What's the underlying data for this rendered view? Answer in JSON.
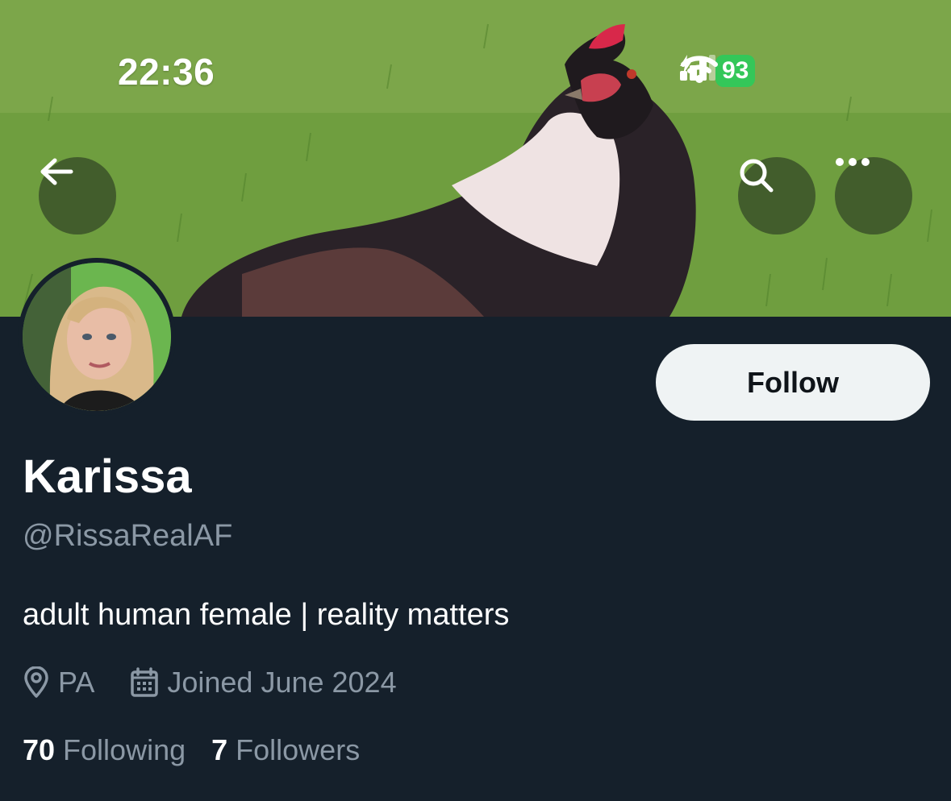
{
  "status_bar": {
    "time": "22:36",
    "battery": "93",
    "icons": [
      "signal-icon",
      "wifi-icon",
      "battery-charging-icon"
    ]
  },
  "nav": {
    "back_icon": "arrow-left-icon",
    "search_icon": "search-icon",
    "more_icon": "more-horizontal-icon"
  },
  "profile": {
    "name": "Karissa",
    "handle": "@RissaRealAF",
    "bio": "adult human female | reality matters",
    "location": "PA",
    "joined": "Joined June 2024",
    "follow_label": "Follow",
    "following_count": "70",
    "following_label": "Following",
    "followers_count": "7",
    "followers_label": "Followers"
  },
  "colors": {
    "background": "#15202b",
    "muted_text": "#8b98a5",
    "follow_button_bg": "#eff3f4",
    "battery_green": "#34c759"
  }
}
